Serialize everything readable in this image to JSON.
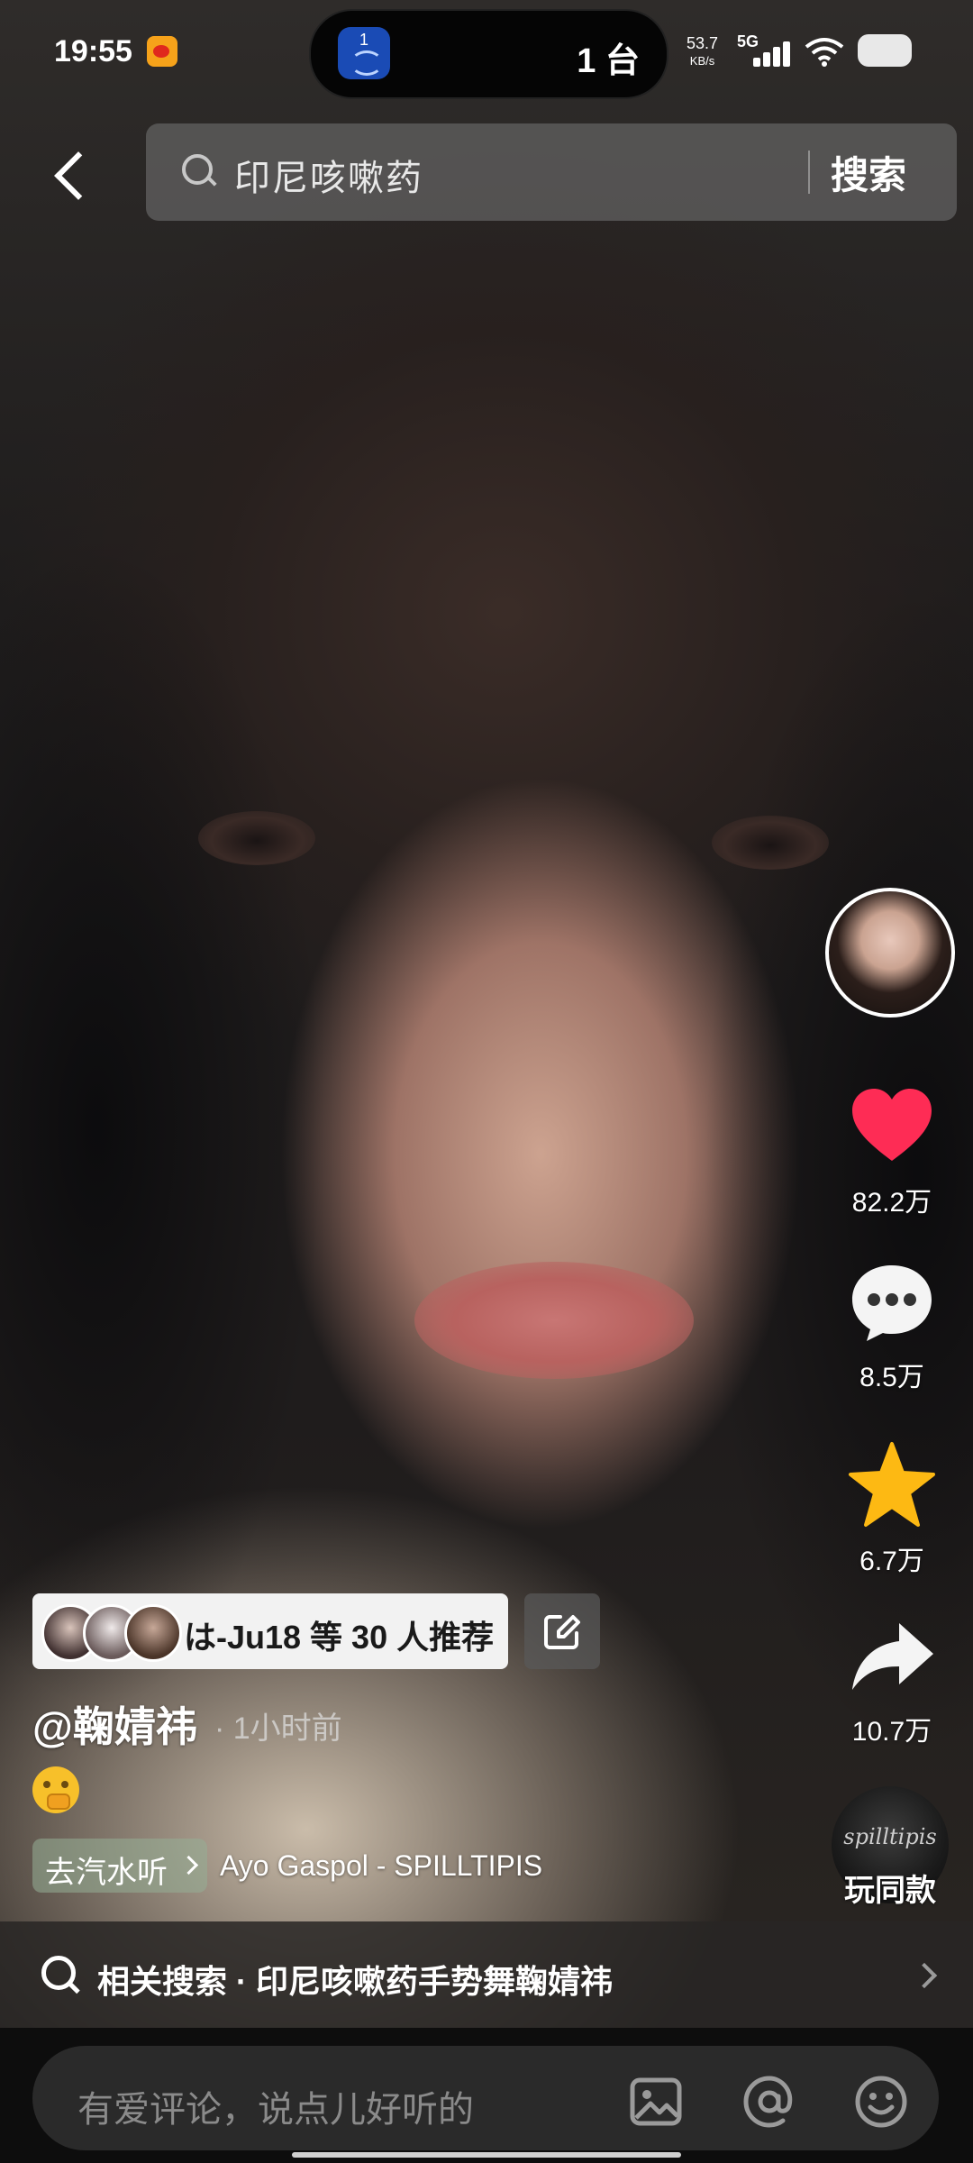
{
  "status_bar": {
    "time": "19:55",
    "island_badge": "1",
    "island_text": "1 台",
    "net_speed": "53.7",
    "net_speed_unit": "KB/s",
    "network": "5G"
  },
  "header": {
    "search_query": "印尼咳嗽药",
    "search_button": "搜索"
  },
  "actions": {
    "like_count": "82.2万",
    "comment_count": "8.5万",
    "favorite_count": "6.7万",
    "share_count": "10.7万",
    "same_style_disc_text": "spilltipis",
    "same_style_label": "玩同款"
  },
  "post": {
    "recommend_text": "は-Ju18 等 30 人推荐",
    "author": "@鞠婧祎",
    "time": "· 1小时前",
    "music_chip": "去汽水听",
    "music_title": "Ayo Gaspol - SPILLTIPIS"
  },
  "related_search": {
    "text": "相关搜索 · 印尼咳嗽药手势舞鞠婧祎"
  },
  "comment_bar": {
    "placeholder": "有爱评论，说点儿好听的"
  },
  "colors": {
    "like": "#fe2c55",
    "favorite": "#fdb913",
    "search_box": "#6e6e6e"
  }
}
